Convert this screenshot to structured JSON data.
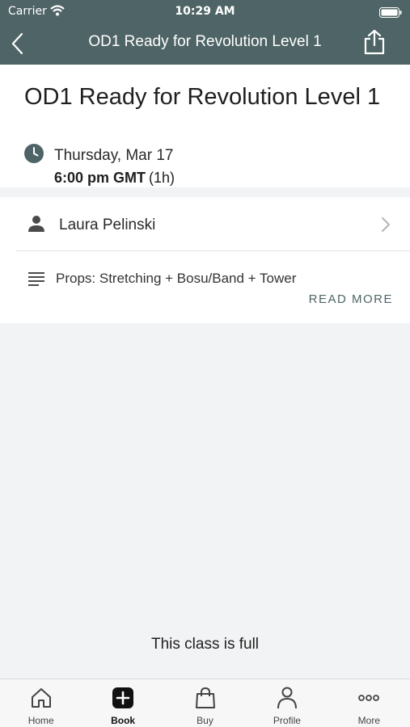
{
  "status_bar": {
    "carrier": "Carrier",
    "time": "10:29 AM"
  },
  "nav": {
    "title": "OD1 Ready for Revolution Level 1",
    "back_icon": "chevron-left-icon",
    "share_icon": "share-icon"
  },
  "class": {
    "title": "OD1 Ready for Revolution Level 1",
    "date": "Thursday, Mar 17",
    "time": "6:00 pm GMT",
    "duration": "(1h)",
    "instructor": "Laura Pelinski",
    "description": "Props: Stretching + Bosu/Band + Tower",
    "read_more": "READ MORE",
    "availability_message": "This class is full"
  },
  "tabs": [
    {
      "label": "Home",
      "icon": "home-icon"
    },
    {
      "label": "Book",
      "icon": "book-plus-icon",
      "active": true
    },
    {
      "label": "Buy",
      "icon": "shopping-bag-icon"
    },
    {
      "label": "Profile",
      "icon": "person-icon"
    },
    {
      "label": "More",
      "icon": "more-dots-icon"
    }
  ],
  "colors": {
    "header_bg": "#4f6466",
    "accent": "#4f6466",
    "page_bg": "#f2f3f5"
  }
}
